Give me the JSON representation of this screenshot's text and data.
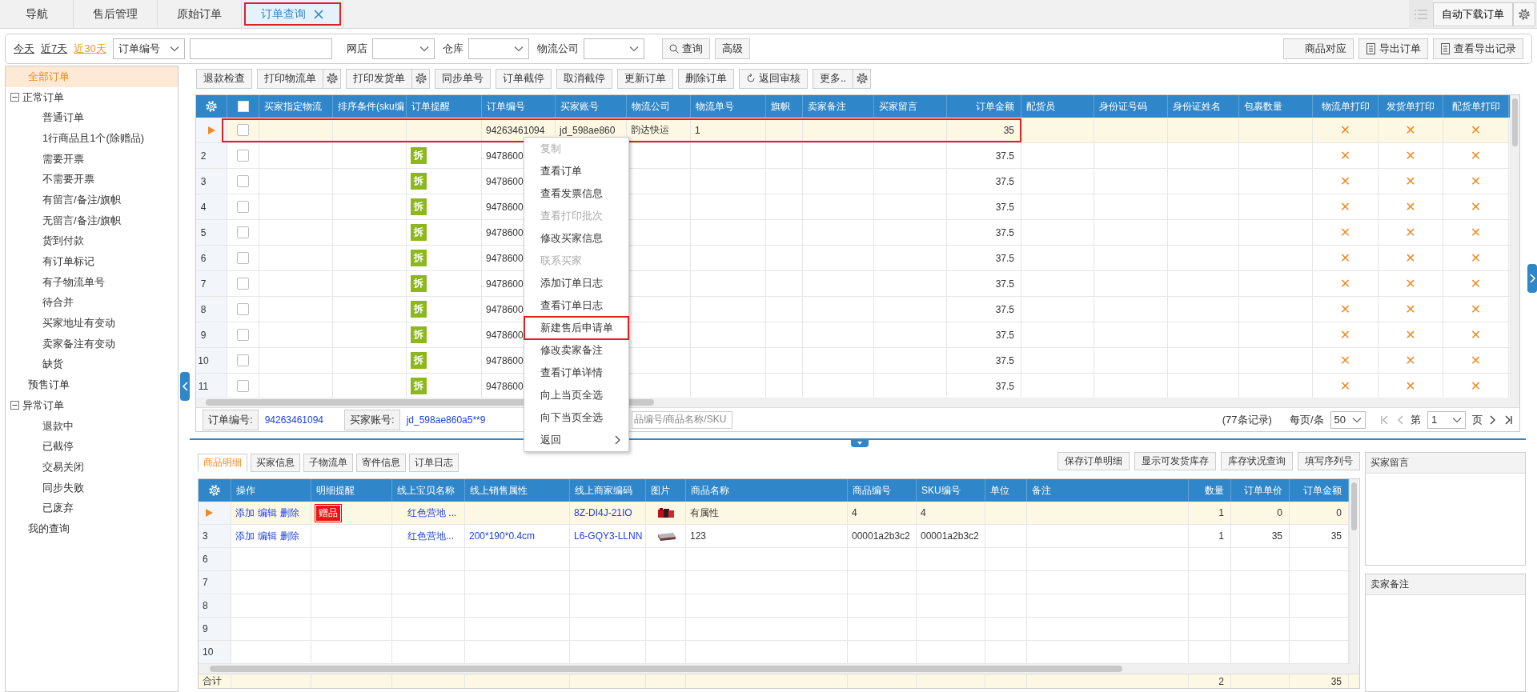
{
  "tabs": [
    {
      "label": "导航",
      "selected": false,
      "closable": false,
      "annotated": false
    },
    {
      "label": "售后管理",
      "selected": false,
      "closable": false,
      "annotated": false
    },
    {
      "label": "原始订单",
      "selected": false,
      "closable": false,
      "annotated": false
    },
    {
      "label": "订单查询",
      "selected": true,
      "closable": true,
      "annotated": true
    }
  ],
  "auto_download_button": "自动下载订单",
  "filter": {
    "date_ranges": [
      {
        "label": "今天",
        "selected": false
      },
      {
        "label": "近7天",
        "selected": false
      },
      {
        "label": "近30天",
        "selected": true
      }
    ],
    "field_select": "订单编号",
    "filters": [
      {
        "label": "网店"
      },
      {
        "label": "仓库"
      },
      {
        "label": "物流公司"
      }
    ],
    "search_button": "查询",
    "advanced_button": "高级",
    "right_buttons": [
      {
        "label": "商品对应",
        "kind": "plain"
      },
      {
        "label": "导出订单",
        "kind": "document"
      },
      {
        "label": "查看导出记录",
        "kind": "document"
      }
    ]
  },
  "sidebar": {
    "items": [
      {
        "label": "全部订单",
        "selected": true
      },
      {
        "label": "正常订单",
        "selected": false,
        "expanded": true,
        "children": [
          {
            "label": "普通订单",
            "selected": false
          },
          {
            "label": "1行商品且1个(除赠品)",
            "selected": false
          },
          {
            "label": "需要开票",
            "selected": false
          },
          {
            "label": "不需要开票",
            "selected": false
          },
          {
            "label": "有留言/备注/旗帜",
            "selected": false
          },
          {
            "label": "无留言/备注/旗帜",
            "selected": false
          },
          {
            "label": "货到付款",
            "selected": false
          },
          {
            "label": "有订单标记",
            "selected": false
          },
          {
            "label": "有子物流单号",
            "selected": false
          },
          {
            "label": "待合并",
            "selected": false
          },
          {
            "label": "买家地址有变动",
            "selected": false
          },
          {
            "label": "卖家备注有变动",
            "selected": false
          },
          {
            "label": "缺货",
            "selected": false
          }
        ]
      },
      {
        "label": "预售订单",
        "selected": false
      },
      {
        "label": "异常订单",
        "selected": false,
        "expanded": true,
        "children": [
          {
            "label": "退款中",
            "selected": false
          },
          {
            "label": "已截停",
            "selected": false
          },
          {
            "label": "交易关闭",
            "selected": false
          },
          {
            "label": "同步失败",
            "selected": false
          },
          {
            "label": "已废弃",
            "selected": false
          }
        ]
      },
      {
        "label": "我的查询",
        "selected": false
      }
    ]
  },
  "toolbar": [
    {
      "label": "退款检查",
      "kind": "plain"
    },
    {
      "label": "打印物流单",
      "kind": "settings"
    },
    {
      "label": "打印发货单",
      "kind": "settings"
    },
    {
      "label": "同步单号",
      "kind": "plain"
    },
    {
      "label": "订单截停",
      "kind": "plain"
    },
    {
      "label": "取消截停",
      "kind": "plain"
    },
    {
      "label": "更新订单",
      "kind": "plain"
    },
    {
      "label": "删除订单",
      "kind": "plain"
    },
    {
      "label": "返回审核",
      "kind": "refresh"
    },
    {
      "label": "更多..",
      "kind": "settings"
    }
  ],
  "orders": {
    "select_all_checked": false,
    "columns": [
      {
        "label": "买家指定物流",
        "kind": "text"
      },
      {
        "label": "排序条件(sku编",
        "kind": "text"
      },
      {
        "label": "订单提醒",
        "kind": "badge"
      },
      {
        "label": "订单编号",
        "kind": "text"
      },
      {
        "label": "买家账号",
        "kind": "text"
      },
      {
        "label": "物流公司",
        "kind": "text"
      },
      {
        "label": "物流单号",
        "kind": "text"
      },
      {
        "label": "旗帜",
        "kind": "text"
      },
      {
        "label": "卖家备注",
        "kind": "text"
      },
      {
        "label": "买家留言",
        "kind": "text"
      },
      {
        "label": "订单金额",
        "kind": "number"
      },
      {
        "label": "配货员",
        "kind": "text"
      },
      {
        "label": "身份证号码",
        "kind": "text"
      },
      {
        "label": "身份证姓名",
        "kind": "text"
      },
      {
        "label": "包裹数量",
        "kind": "text"
      },
      {
        "label": "物流单打印",
        "kind": "mark"
      },
      {
        "label": "发货单打印",
        "kind": "mark"
      },
      {
        "label": "配货单打印",
        "kind": "mark"
      }
    ],
    "rows": [
      {
        "selected": true,
        "annotated": true,
        "checked": false,
        "order_no": "94263461094",
        "buyer": "jd_598ae860",
        "carrier": "韵达快运",
        "tracking_no": "1",
        "amount": "35",
        "waybill_print": "✕",
        "invoice_print": "✕",
        "picking_print": "✕"
      },
      {
        "num": "2",
        "selected": false,
        "annotated": false,
        "checked": false,
        "reminder": "拆",
        "order_no": "9478600",
        "amount": "37.5",
        "waybill_print": "✕",
        "invoice_print": "✕",
        "picking_print": "✕"
      },
      {
        "num": "3",
        "selected": false,
        "annotated": false,
        "checked": false,
        "reminder": "拆",
        "order_no": "9478600",
        "amount": "37.5",
        "waybill_print": "✕",
        "invoice_print": "✕",
        "picking_print": "✕"
      },
      {
        "num": "4",
        "selected": false,
        "annotated": false,
        "checked": false,
        "reminder": "拆",
        "order_no": "9478600",
        "amount": "37.5",
        "waybill_print": "✕",
        "invoice_print": "✕",
        "picking_print": "✕"
      },
      {
        "num": "5",
        "selected": false,
        "annotated": false,
        "checked": false,
        "reminder": "拆",
        "order_no": "9478600",
        "amount": "37.5",
        "waybill_print": "✕",
        "invoice_print": "✕",
        "picking_print": "✕"
      },
      {
        "num": "6",
        "selected": false,
        "annotated": false,
        "checked": false,
        "reminder": "拆",
        "order_no": "9478600",
        "amount": "37.5",
        "waybill_print": "✕",
        "invoice_print": "✕",
        "picking_print": "✕"
      },
      {
        "num": "7",
        "selected": false,
        "annotated": false,
        "checked": false,
        "reminder": "拆",
        "order_no": "9478600",
        "amount": "37.5",
        "waybill_print": "✕",
        "invoice_print": "✕",
        "picking_print": "✕"
      },
      {
        "num": "8",
        "selected": false,
        "annotated": false,
        "checked": false,
        "reminder": "拆",
        "order_no": "9478600",
        "amount": "37.5",
        "waybill_print": "✕",
        "invoice_print": "✕",
        "picking_print": "✕"
      },
      {
        "num": "9",
        "selected": false,
        "annotated": false,
        "checked": false,
        "reminder": "拆",
        "order_no": "9478600",
        "amount": "37.5",
        "waybill_print": "✕",
        "invoice_print": "✕",
        "picking_print": "✕"
      },
      {
        "num": "10",
        "selected": false,
        "annotated": false,
        "checked": false,
        "reminder": "拆",
        "order_no": "9478600",
        "amount": "37.5",
        "waybill_print": "✕",
        "invoice_print": "✕",
        "picking_print": "✕"
      },
      {
        "num": "11",
        "selected": false,
        "annotated": false,
        "checked": false,
        "reminder": "拆",
        "order_no": "9478600",
        "amount": "37.5",
        "waybill_print": "✕",
        "invoice_print": "✕",
        "picking_print": "✕"
      }
    ],
    "context_menu": [
      {
        "label": "复制",
        "disabled": true,
        "annotated": false,
        "submenu": false
      },
      {
        "label": "查看订单",
        "disabled": false,
        "annotated": false,
        "submenu": false
      },
      {
        "label": "查看发票信息",
        "disabled": false,
        "annotated": false,
        "submenu": false
      },
      {
        "label": "查看打印批次",
        "disabled": true,
        "annotated": false,
        "submenu": false
      },
      {
        "label": "修改买家信息",
        "disabled": false,
        "annotated": false,
        "submenu": false
      },
      {
        "label": "联系买家",
        "disabled": true,
        "annotated": false,
        "submenu": false
      },
      {
        "label": "添加订单日志",
        "disabled": false,
        "annotated": false,
        "submenu": false
      },
      {
        "label": "查看订单日志",
        "disabled": false,
        "annotated": false,
        "submenu": false
      },
      {
        "label": "新建售后申请单",
        "disabled": false,
        "annotated": true,
        "submenu": false
      },
      {
        "label": "修改卖家备注",
        "disabled": false,
        "annotated": false,
        "submenu": false
      },
      {
        "label": "查看订单详情",
        "disabled": false,
        "annotated": false,
        "submenu": false
      },
      {
        "label": "向上当页全选",
        "disabled": false,
        "annotated": false,
        "submenu": false
      },
      {
        "label": "向下当页全选",
        "disabled": false,
        "annotated": false,
        "submenu": false
      },
      {
        "label": "返回",
        "disabled": false,
        "annotated": false,
        "submenu": true
      }
    ],
    "footer": {
      "order_no_label": "订单编号:",
      "order_no": "94263461094",
      "buyer_label": "买家账号:",
      "buyer": "jd_598ae860a5**9",
      "product_search_placeholder": "品编号/商品名称/SKU",
      "record_count": "(77条记录)",
      "per_page_label": "每页/条",
      "per_page": "50",
      "page_label": "第",
      "page": "1",
      "page_suffix": "页"
    }
  },
  "detail": {
    "tabs": [
      {
        "label": "商品明细",
        "selected": true
      },
      {
        "label": "买家信息",
        "selected": false
      },
      {
        "label": "子物流单",
        "selected": false
      },
      {
        "label": "寄件信息",
        "selected": false
      },
      {
        "label": "订单日志",
        "selected": false
      }
    ],
    "buttons": [
      "保存订单明细",
      "显示可发货库存",
      "库存状况查询",
      "填写序列号"
    ],
    "columns": [
      {
        "label": "操作",
        "kind": "links"
      },
      {
        "label": "明细提醒",
        "kind": "badge"
      },
      {
        "label": "线上宝贝名称",
        "kind": "link"
      },
      {
        "label": "线上销售属性",
        "kind": "link"
      },
      {
        "label": "线上商家编码",
        "kind": "link"
      },
      {
        "label": "图片",
        "kind": "picture"
      },
      {
        "label": "商品名称",
        "kind": "text"
      },
      {
        "label": "商品编号",
        "kind": "text"
      },
      {
        "label": "SKU编号",
        "kind": "text"
      },
      {
        "label": "单位",
        "kind": "text"
      },
      {
        "label": "备注",
        "kind": "text"
      },
      {
        "label": "数量",
        "kind": "number"
      },
      {
        "label": "订单单价",
        "kind": "number"
      },
      {
        "label": "订单金额",
        "kind": "number"
      }
    ],
    "rows": [
      {
        "selected": true,
        "actions": [
          "添加",
          "编辑",
          "删除"
        ],
        "reminder": "赠品",
        "online_name": "红色营地 ...",
        "merchant_code": "8Z-DI4J-21IO",
        "image": {
          "kind": "picture"
        },
        "name": "有属性",
        "product_no": "4",
        "sku": "4",
        "qty": "1",
        "price": "0",
        "amount": "0"
      },
      {
        "num": "3",
        "selected": false,
        "actions": [
          "添加",
          "编辑",
          "删除"
        ],
        "online_name": "红色营地...",
        "sale_attr": "200*190*0.4cm",
        "merchant_code": "L6-GQY3-LLNN",
        "image": {
          "kind": "picture"
        },
        "name": "123",
        "product_no": "00001a2b3c2",
        "sku": "00001a2b3c2",
        "qty": "1",
        "price": "35",
        "amount": "35"
      },
      {
        "num": "6",
        "selected": false
      },
      {
        "num": "7",
        "selected": false
      },
      {
        "num": "8",
        "selected": false
      },
      {
        "num": "9",
        "selected": false
      },
      {
        "num": "10",
        "selected": false
      }
    ],
    "total": {
      "label": "合计",
      "qty": "2",
      "amount": "35"
    }
  },
  "side_panels": [
    {
      "title": "买家留言"
    },
    {
      "title": "卖家备注"
    }
  ]
}
